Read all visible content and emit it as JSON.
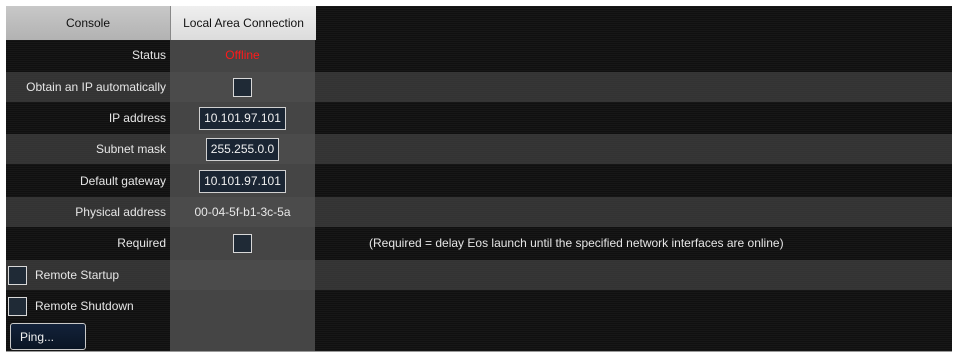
{
  "header": {
    "console_tab": "Console",
    "lan_tab": "Local Area Connection"
  },
  "rows": {
    "status": {
      "label": "Status",
      "value": "Offline",
      "color": "#ff1a1a"
    },
    "obtain_ip": {
      "label": "Obtain an IP automatically",
      "checked": false
    },
    "ip_address": {
      "label": "IP address",
      "value": "10.101.97.101"
    },
    "subnet_mask": {
      "label": "Subnet mask",
      "value": "255.255.0.0"
    },
    "default_gateway": {
      "label": "Default gateway",
      "value": "10.101.97.101"
    },
    "physical_address": {
      "label": "Physical address",
      "value": "00-04-5f-b1-3c-5a"
    },
    "required": {
      "label": "Required",
      "checked": false,
      "note": "(Required = delay Eos launch until the specified network interfaces are online)"
    }
  },
  "options": {
    "remote_startup": {
      "label": "Remote Startup",
      "checked": false
    },
    "remote_shutdown": {
      "label": "Remote Shutdown",
      "checked": false
    }
  },
  "actions": {
    "ping_label": "Ping..."
  }
}
